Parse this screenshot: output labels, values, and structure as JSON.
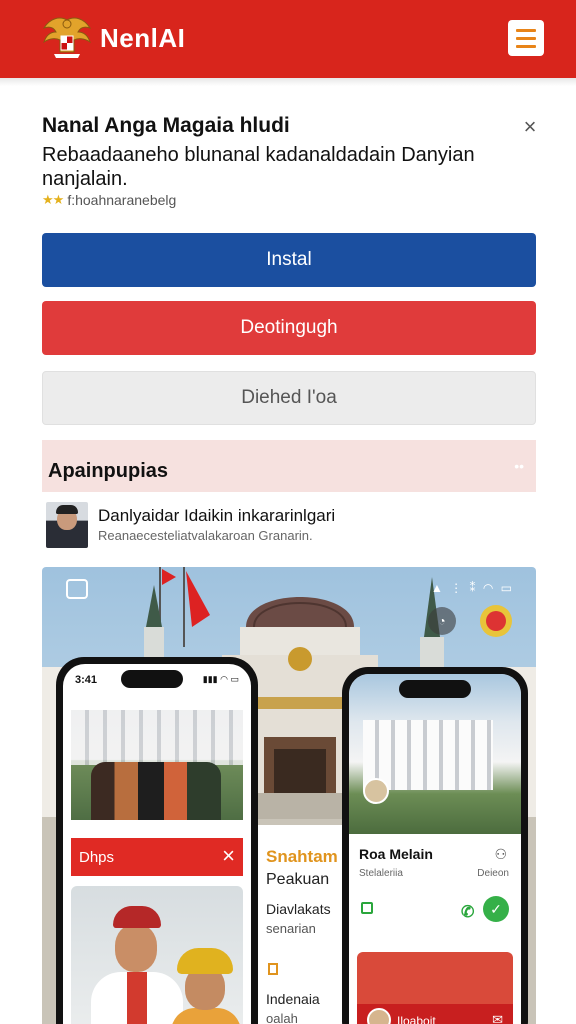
{
  "header": {
    "brand": "NenlAI",
    "logo_icon": "garuda-emblem-icon",
    "menu_icon": "hamburger-menu-icon",
    "bg_color": "#d8251c"
  },
  "app": {
    "title": "Nanal Anga Magaia hludi",
    "close_symbol": "×",
    "description": "Rebaadaaneho blunanal kadanaldadain Danyian nanjalain.",
    "rating_stars": "★★",
    "rating_text": "f:hoahnaranebelg",
    "rating": 2
  },
  "buttons": {
    "install": "Instal",
    "secondary": "Deotingugh",
    "tertiary": "Diehed I'oa"
  },
  "section": {
    "title": "Apainpupias",
    "dots": "••"
  },
  "developer": {
    "name": "Danlyaidar Idaikin inkararinlgari",
    "subtitle": "Reanaecesteliatvalakaroan Granarin."
  },
  "hero": {
    "status": "▲ ⋮ ⁑ ◠ ▭",
    "phone_left": {
      "time": "3:41",
      "signal": "▮▮▮ ◠ ▭",
      "bar_label": "Dhps",
      "bar_close": "×"
    },
    "middle": {
      "title": "Snahtam",
      "line1": "Peakuan",
      "line2": "Diavlakats",
      "line3": "senarian",
      "line4": "Indenaia",
      "line5": "oalah"
    },
    "phone_right": {
      "name": "Roa Melain",
      "sub": "Stelaleriia",
      "user_icon": "⚇",
      "sub_right": "Deieon",
      "call_icon": "✆",
      "play_icon": "✓",
      "card_label": "Iloaboit",
      "mail_icon": "✉"
    }
  },
  "colors": {
    "install": "#1b4fa0",
    "secondary": "#e03b3b",
    "tertiary": "#ececec",
    "section_bg": "#f6e1df",
    "accent": "#e0941e"
  }
}
